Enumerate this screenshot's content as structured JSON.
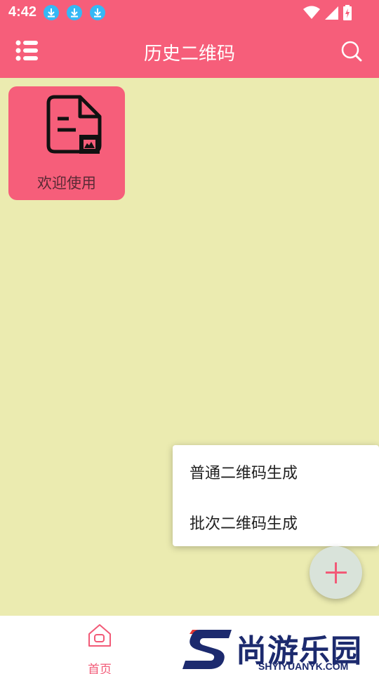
{
  "status_bar": {
    "time": "4:42"
  },
  "app_bar": {
    "title": "历史二维码"
  },
  "cards": [
    {
      "label": "欢迎使用"
    }
  ],
  "popup_menu": {
    "items": [
      {
        "label": "普通二维码生成"
      },
      {
        "label": "批次二维码生成"
      }
    ]
  },
  "bottom_nav": {
    "items": [
      {
        "label": "首页"
      }
    ]
  },
  "watermark": {
    "title": "尚游乐园",
    "url": "SHYIYUANYK.COM"
  },
  "colors": {
    "primary": "#f65e7a",
    "background": "#ebebb0",
    "fab_bg": "#d9e3da",
    "accent": "#f25a77"
  }
}
